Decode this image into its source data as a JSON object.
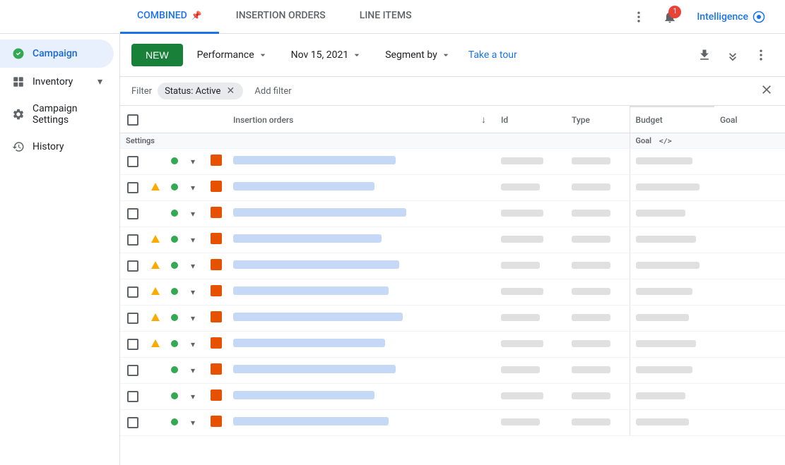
{
  "topNav": {
    "tabs": [
      {
        "id": "combined",
        "label": "COMBINED",
        "active": true,
        "pinned": true
      },
      {
        "id": "insertion-orders",
        "label": "INSERTION ORDERS",
        "active": false
      },
      {
        "id": "line-items",
        "label": "LINE ITEMS",
        "active": false
      }
    ],
    "intelligenceLabel": "Intelligence",
    "notificationCount": "1"
  },
  "sidebar": {
    "items": [
      {
        "id": "campaign",
        "label": "Campaign",
        "icon": "campaign",
        "active": true
      },
      {
        "id": "inventory",
        "label": "Inventory",
        "icon": "inventory",
        "active": false,
        "expandable": true
      },
      {
        "id": "campaign-settings",
        "label": "Campaign Settings",
        "icon": "settings",
        "active": false
      },
      {
        "id": "history",
        "label": "History",
        "icon": "history",
        "active": false
      }
    ]
  },
  "toolbar": {
    "newButtonLabel": "NEW",
    "performanceLabel": "Performance",
    "dateLabel": "Nov 15, 2021",
    "segmentLabel": "Segment by",
    "takeTourLabel": "Take a tour"
  },
  "filterBar": {
    "filterLabel": "Filter",
    "activeFilterLabel": "Status: Active",
    "addFilterLabel": "Add filter"
  },
  "table": {
    "headers": {
      "insertionOrders": "Insertion orders",
      "id": "Id",
      "type": "Type",
      "settings": "Settings",
      "budget": "Budget",
      "goal": "Goal",
      "goalSub": "Goal"
    },
    "rows": [
      {
        "statusWarning": false,
        "statusActive": true,
        "nameWidth": 230,
        "idWidth": 60,
        "typeWidth": 55,
        "budgetWidth": 80
      },
      {
        "statusWarning": true,
        "statusActive": true,
        "nameWidth": 200,
        "idWidth": 55,
        "typeWidth": 55,
        "budgetWidth": 90
      },
      {
        "statusWarning": false,
        "statusActive": true,
        "nameWidth": 245,
        "idWidth": 60,
        "typeWidth": 55,
        "budgetWidth": 70
      },
      {
        "statusWarning": true,
        "statusActive": true,
        "nameWidth": 210,
        "idWidth": 60,
        "typeWidth": 55,
        "budgetWidth": 85
      },
      {
        "statusWarning": true,
        "statusActive": true,
        "nameWidth": 235,
        "idWidth": 55,
        "typeWidth": 55,
        "budgetWidth": 90
      },
      {
        "statusWarning": true,
        "statusActive": true,
        "nameWidth": 220,
        "idWidth": 60,
        "typeWidth": 55,
        "budgetWidth": 80
      },
      {
        "statusWarning": true,
        "statusActive": true,
        "nameWidth": 240,
        "idWidth": 55,
        "typeWidth": 55,
        "budgetWidth": 75
      },
      {
        "statusWarning": true,
        "statusActive": true,
        "nameWidth": 215,
        "idWidth": 60,
        "typeWidth": 55,
        "budgetWidth": 85
      },
      {
        "statusWarning": false,
        "statusActive": true,
        "nameWidth": 230,
        "idWidth": 55,
        "typeWidth": 55,
        "budgetWidth": 80
      },
      {
        "statusWarning": false,
        "statusActive": true,
        "nameWidth": 200,
        "idWidth": 60,
        "typeWidth": 55,
        "budgetWidth": 70
      },
      {
        "statusWarning": false,
        "statusActive": true,
        "nameWidth": 220,
        "idWidth": 55,
        "typeWidth": 55,
        "budgetWidth": 75
      }
    ]
  }
}
